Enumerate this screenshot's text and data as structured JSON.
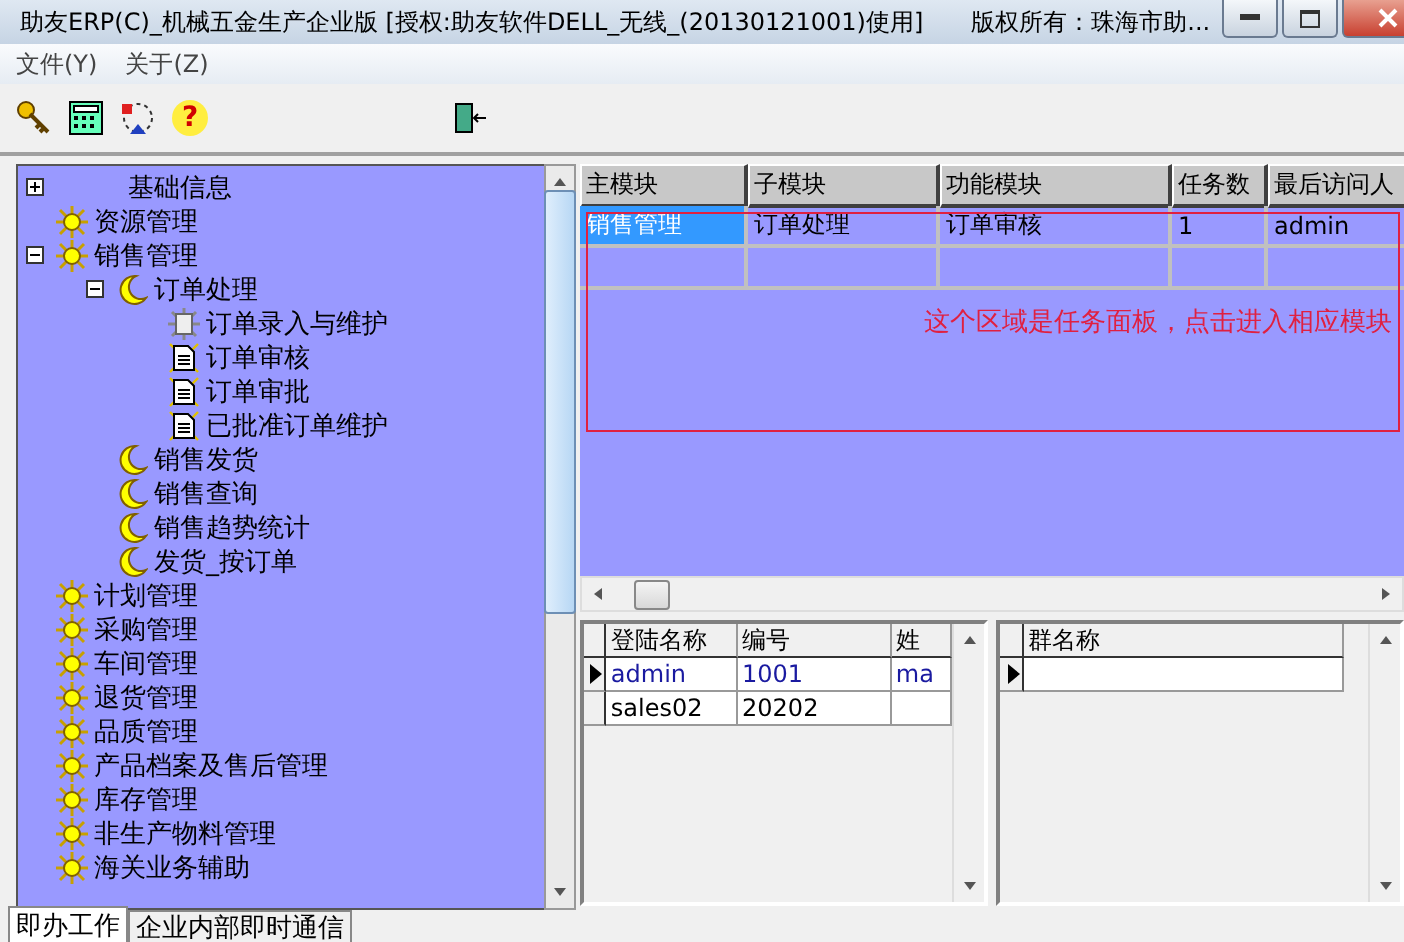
{
  "window": {
    "title": "助友ERP(C)_机械五金生产企业版  [授权:助友软件DELL_无线_(20130121001)使用]",
    "copyright": "版权所有：珠海市助..."
  },
  "menu": [
    "文件(Y)",
    "关于(Z)"
  ],
  "toolbar": [
    {
      "kind": "key"
    },
    {
      "kind": "calculator"
    },
    {
      "kind": "cycle"
    },
    {
      "kind": "help",
      "glyph": "?"
    },
    {
      "kind": "exit"
    }
  ],
  "tree": [
    {
      "label": "基础信息",
      "kind": "plain",
      "expanded": false
    },
    {
      "label": "资源管理",
      "kind": "sun"
    },
    {
      "label": "销售管理",
      "kind": "sun",
      "expanded": true,
      "children": [
        {
          "label": "订单处理",
          "kind": "moon",
          "expanded": true,
          "children": [
            {
              "label": "订单录入与维护",
              "kind": "gear"
            },
            {
              "label": "订单审核",
              "kind": "doc"
            },
            {
              "label": "订单审批",
              "kind": "doc"
            },
            {
              "label": "已批准订单维护",
              "kind": "doc"
            }
          ]
        },
        {
          "label": "销售发货",
          "kind": "moon"
        },
        {
          "label": "销售查询",
          "kind": "moon"
        },
        {
          "label": "销售趋势统计",
          "kind": "moon"
        },
        {
          "label": "发货_按订单",
          "kind": "moon"
        }
      ]
    },
    {
      "label": "计划管理",
      "kind": "sun"
    },
    {
      "label": "采购管理",
      "kind": "sun"
    },
    {
      "label": "车间管理",
      "kind": "sun"
    },
    {
      "label": "退货管理",
      "kind": "sun"
    },
    {
      "label": "品质管理",
      "kind": "sun"
    },
    {
      "label": "产品档案及售后管理",
      "kind": "sun"
    },
    {
      "label": "库存管理",
      "kind": "sun"
    },
    {
      "label": "非生产物料管理",
      "kind": "sun"
    },
    {
      "label": "海关业务辅助",
      "kind": "sun"
    }
  ],
  "task_grid": {
    "columns": [
      "主模块",
      "子模块",
      "功能模块",
      "任务数",
      "最后访问人"
    ],
    "rows": [
      {
        "cells": [
          "销售管理",
          "订单处理",
          "订单审核",
          "1",
          "admin"
        ],
        "selected": true
      },
      {
        "cells": [
          "",
          "",
          "",
          "",
          ""
        ],
        "selected": false
      }
    ],
    "note": "这个区域是任务面板，点击进入相应模块"
  },
  "user_grid": {
    "columns": [
      "登陆名称",
      "编号",
      "姓"
    ],
    "rows": [
      {
        "cells": [
          "admin",
          "1001",
          "ma"
        ],
        "current": true
      },
      {
        "cells": [
          "sales02",
          "20202",
          ""
        ],
        "current": false
      }
    ]
  },
  "group_grid": {
    "columns": [
      "群名称"
    ],
    "rows": [
      {
        "cells": [
          ""
        ],
        "current": true
      }
    ]
  },
  "tabs": [
    {
      "label": "即办工作",
      "selected": true
    },
    {
      "label": "企业内部即时通信",
      "selected": false
    }
  ]
}
